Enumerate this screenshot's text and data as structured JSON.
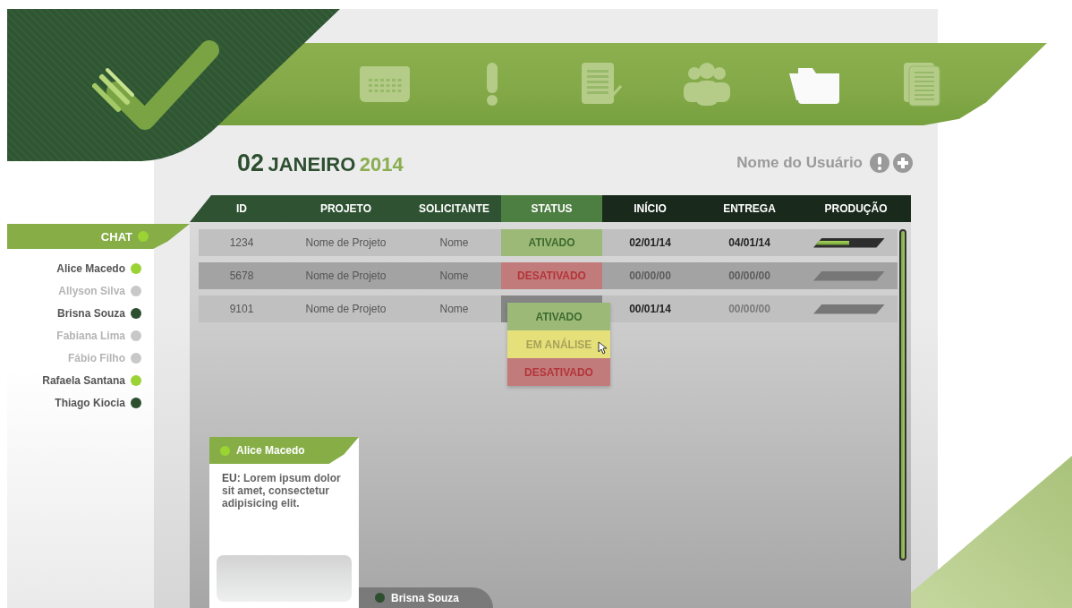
{
  "header": {
    "nav_items": [
      {
        "kind": "calendar",
        "selected": false
      },
      {
        "kind": "alert",
        "selected": false
      },
      {
        "kind": "document",
        "selected": false
      },
      {
        "kind": "people",
        "selected": false
      },
      {
        "kind": "folder",
        "selected": true
      },
      {
        "kind": "documents",
        "selected": false
      }
    ]
  },
  "date": {
    "day": "02",
    "month": "JANEIRO",
    "year": "2014"
  },
  "user": {
    "name": "Nome do Usuário"
  },
  "sidebar": {
    "title": "CHAT",
    "color": "#9bd234",
    "contacts": [
      {
        "name": "Alice Macedo",
        "kind": "online",
        "color": "#9bd234"
      },
      {
        "name": "Allyson Silva",
        "kind": "offline",
        "color": "#c8c8c8"
      },
      {
        "name": "Brisna Souza",
        "kind": "busy",
        "color": "#2d4f30"
      },
      {
        "name": "Fabiana Lima",
        "kind": "offline",
        "color": "#c8c8c8"
      },
      {
        "name": "Fábio Filho",
        "kind": "offline",
        "color": "#c8c8c8"
      },
      {
        "name": "Rafaela Santana",
        "kind": "online",
        "color": "#9bd234"
      },
      {
        "name": "Thiago Kiocia",
        "kind": "busy",
        "color": "#2d4f30"
      }
    ]
  },
  "table": {
    "columns": [
      {
        "label": "ID",
        "kind": "project"
      },
      {
        "label": "PROJETO",
        "kind": "project"
      },
      {
        "label": "SOLICITANTE",
        "kind": "project"
      },
      {
        "label": "STATUS",
        "kind": "status"
      },
      {
        "label": "INÍCIO",
        "kind": "schedule"
      },
      {
        "label": "ENTREGA",
        "kind": "schedule"
      },
      {
        "label": "PRODUÇÃO",
        "kind": "schedule"
      }
    ],
    "rows": [
      {
        "id": "1234",
        "project": "Nome de Projeto",
        "requester": "Nome",
        "disabled": false,
        "status": {
          "kind": "ativado",
          "label": "ATIVADO"
        },
        "start": {
          "text": "02/01/14",
          "dimmed": false
        },
        "delivery": {
          "text": "04/01/14",
          "dimmed": false
        },
        "production": {
          "level": 0.5,
          "active": true
        }
      },
      {
        "id": "5678",
        "project": "Nome de Projeto",
        "requester": "Nome",
        "disabled": true,
        "status": {
          "kind": "desativado",
          "label": "DESATIVADO"
        },
        "start": {
          "text": "00/00/00",
          "dimmed": true
        },
        "delivery": {
          "text": "00/00/00",
          "dimmed": true
        },
        "production": {
          "level": 0,
          "active": false
        }
      },
      {
        "id": "9101",
        "project": "Nome de Projeto",
        "requester": "Nome",
        "disabled": false,
        "status": {
          "kind": "open",
          "menu": [
            {
              "kind": "ativado",
              "label": "ATIVADO",
              "hovered": false
            },
            {
              "kind": "em_analise",
              "label": "EM ANÁLISE",
              "hovered": true
            },
            {
              "kind": "desativado",
              "label": "DESATIVADO",
              "hovered": false
            }
          ]
        },
        "start": {
          "text": "00/01/14",
          "dimmed": false
        },
        "delivery": {
          "text": "00/00/00",
          "dimmed": true
        },
        "production": {
          "level": 0,
          "active": false
        }
      }
    ]
  },
  "chat_windows": [
    {
      "contact": "Alice Macedo",
      "color": "#9bd234",
      "expanded": true,
      "message": "**EU:** Lorem ipsum dolor sit amet, consectetur adipisicing elit."
    },
    {
      "contact": "Brisna Souza",
      "color": "#2d4f30",
      "expanded": false
    }
  ]
}
